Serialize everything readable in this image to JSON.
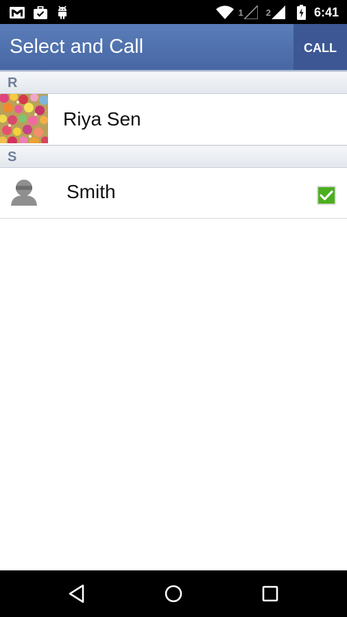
{
  "status_bar": {
    "sim1_label": "1",
    "sim2_label": "2",
    "time": "6:41",
    "icons": [
      "gmail-icon",
      "briefcase-icon",
      "android-icon",
      "wifi-icon",
      "signal-sim1-icon",
      "signal-sim2-icon",
      "battery-charging-icon"
    ]
  },
  "action_bar": {
    "title": "Select and Call",
    "call_label": "CALL"
  },
  "sections": [
    {
      "letter": "R",
      "contacts": [
        {
          "name": "Riya Sen",
          "avatar": "flower-photo",
          "checked": false
        }
      ]
    },
    {
      "letter": "S",
      "contacts": [
        {
          "name": "Smith",
          "avatar": "default-person-icon",
          "checked": true
        }
      ]
    }
  ],
  "colors": {
    "action_bar": "#4f70ad",
    "call_button": "#3c5794",
    "checkbox_checked": "#4caf1f",
    "section_letter": "#6f7f99"
  },
  "nav_bar": {
    "icons": [
      "back-icon",
      "home-icon",
      "recents-icon"
    ]
  }
}
